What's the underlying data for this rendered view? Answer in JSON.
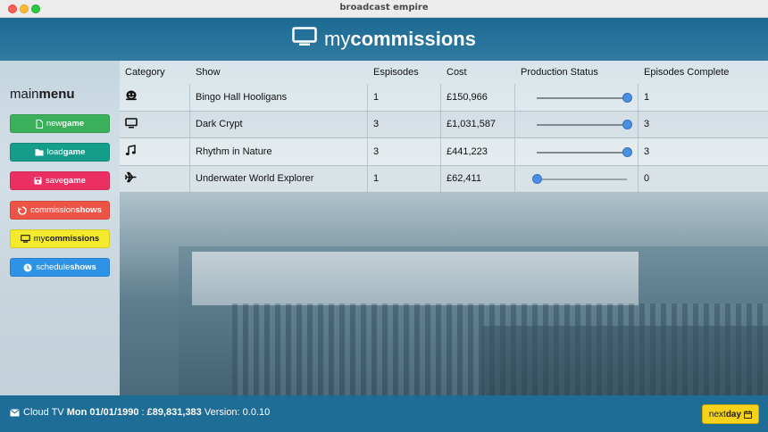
{
  "window": {
    "title": "broadcast empire"
  },
  "header": {
    "title_light": "my",
    "title_bold": "commissions",
    "icon": "tv-icon"
  },
  "sidebar": {
    "title_light": "main",
    "title_bold": "menu",
    "buttons": [
      {
        "light": "new",
        "bold": "game",
        "icon": "file-icon",
        "color": "#3bb05a"
      },
      {
        "light": "load",
        "bold": "game",
        "icon": "folder-icon",
        "color": "#169c8b"
      },
      {
        "light": "save",
        "bold": "game",
        "icon": "floppy-icon",
        "color": "#eb2f63"
      },
      {
        "light": "commission",
        "bold": "shows",
        "icon": "sync-icon",
        "color": "#ee5446"
      },
      {
        "light": "my",
        "bold": "commissions",
        "icon": "tv-icon",
        "color": "#f3ea2b"
      },
      {
        "light": "schedule",
        "bold": "shows",
        "icon": "clock-icon",
        "color": "#2e93e6"
      }
    ]
  },
  "table": {
    "headers": [
      "Category",
      "Show",
      "Espisodes",
      "Cost",
      "Production Status",
      "Episodes Complete"
    ],
    "rows": [
      {
        "category_icon": "theater-mask-icon",
        "show": "Bingo Hall Hooligans",
        "episodes": "1",
        "cost": "£150,966",
        "progress": 1.0,
        "complete": "1"
      },
      {
        "category_icon": "tv-icon",
        "show": "Dark Crypt",
        "episodes": "3",
        "cost": "£1,031,587",
        "progress": 1.0,
        "complete": "3"
      },
      {
        "category_icon": "music-icon",
        "show": "Rhythm in Nature",
        "episodes": "3",
        "cost": "£441,223",
        "progress": 1.0,
        "complete": "3"
      },
      {
        "category_icon": "plane-icon",
        "show": "Underwater World Explorer",
        "episodes": "1",
        "cost": "£62,411",
        "progress": 0.0,
        "complete": "0"
      }
    ]
  },
  "status": {
    "icon": "envelope-icon",
    "channel": "Cloud TV",
    "date": "Mon 01/01/1990",
    "separator": ":",
    "money": "£89,831,383",
    "version_label": "Version:",
    "version": "0.0.10"
  },
  "next_day": {
    "light": "next",
    "bold": "day",
    "icon": "calendar-icon"
  },
  "colors": {
    "accent_blue": "#1e6d96",
    "slider_knob": "#4a90e2",
    "next_day": "#f7d21a"
  }
}
